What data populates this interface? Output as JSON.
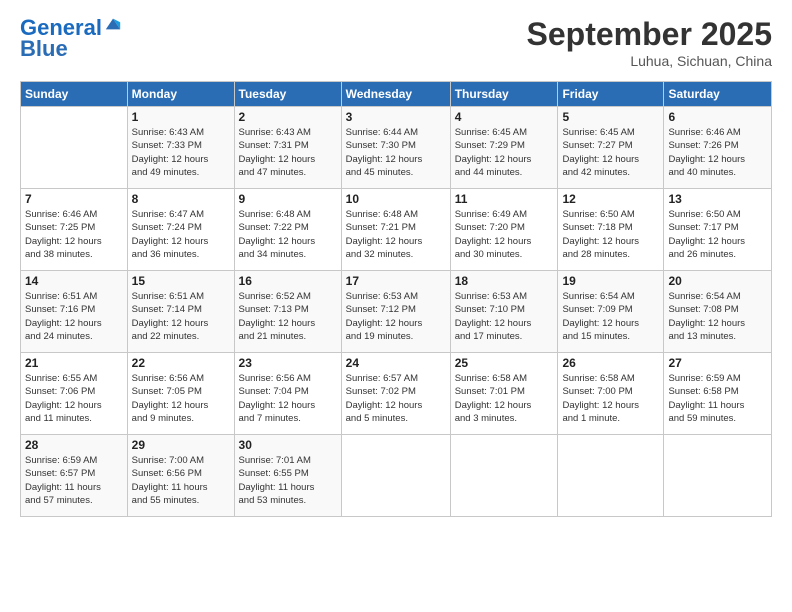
{
  "header": {
    "logo_line1": "General",
    "logo_line2": "Blue",
    "month_title": "September 2025",
    "location": "Luhua, Sichuan, China"
  },
  "weekdays": [
    "Sunday",
    "Monday",
    "Tuesday",
    "Wednesday",
    "Thursday",
    "Friday",
    "Saturday"
  ],
  "weeks": [
    [
      {
        "day": "",
        "info": ""
      },
      {
        "day": "1",
        "info": "Sunrise: 6:43 AM\nSunset: 7:33 PM\nDaylight: 12 hours\nand 49 minutes."
      },
      {
        "day": "2",
        "info": "Sunrise: 6:43 AM\nSunset: 7:31 PM\nDaylight: 12 hours\nand 47 minutes."
      },
      {
        "day": "3",
        "info": "Sunrise: 6:44 AM\nSunset: 7:30 PM\nDaylight: 12 hours\nand 45 minutes."
      },
      {
        "day": "4",
        "info": "Sunrise: 6:45 AM\nSunset: 7:29 PM\nDaylight: 12 hours\nand 44 minutes."
      },
      {
        "day": "5",
        "info": "Sunrise: 6:45 AM\nSunset: 7:27 PM\nDaylight: 12 hours\nand 42 minutes."
      },
      {
        "day": "6",
        "info": "Sunrise: 6:46 AM\nSunset: 7:26 PM\nDaylight: 12 hours\nand 40 minutes."
      }
    ],
    [
      {
        "day": "7",
        "info": "Sunrise: 6:46 AM\nSunset: 7:25 PM\nDaylight: 12 hours\nand 38 minutes."
      },
      {
        "day": "8",
        "info": "Sunrise: 6:47 AM\nSunset: 7:24 PM\nDaylight: 12 hours\nand 36 minutes."
      },
      {
        "day": "9",
        "info": "Sunrise: 6:48 AM\nSunset: 7:22 PM\nDaylight: 12 hours\nand 34 minutes."
      },
      {
        "day": "10",
        "info": "Sunrise: 6:48 AM\nSunset: 7:21 PM\nDaylight: 12 hours\nand 32 minutes."
      },
      {
        "day": "11",
        "info": "Sunrise: 6:49 AM\nSunset: 7:20 PM\nDaylight: 12 hours\nand 30 minutes."
      },
      {
        "day": "12",
        "info": "Sunrise: 6:50 AM\nSunset: 7:18 PM\nDaylight: 12 hours\nand 28 minutes."
      },
      {
        "day": "13",
        "info": "Sunrise: 6:50 AM\nSunset: 7:17 PM\nDaylight: 12 hours\nand 26 minutes."
      }
    ],
    [
      {
        "day": "14",
        "info": "Sunrise: 6:51 AM\nSunset: 7:16 PM\nDaylight: 12 hours\nand 24 minutes."
      },
      {
        "day": "15",
        "info": "Sunrise: 6:51 AM\nSunset: 7:14 PM\nDaylight: 12 hours\nand 22 minutes."
      },
      {
        "day": "16",
        "info": "Sunrise: 6:52 AM\nSunset: 7:13 PM\nDaylight: 12 hours\nand 21 minutes."
      },
      {
        "day": "17",
        "info": "Sunrise: 6:53 AM\nSunset: 7:12 PM\nDaylight: 12 hours\nand 19 minutes."
      },
      {
        "day": "18",
        "info": "Sunrise: 6:53 AM\nSunset: 7:10 PM\nDaylight: 12 hours\nand 17 minutes."
      },
      {
        "day": "19",
        "info": "Sunrise: 6:54 AM\nSunset: 7:09 PM\nDaylight: 12 hours\nand 15 minutes."
      },
      {
        "day": "20",
        "info": "Sunrise: 6:54 AM\nSunset: 7:08 PM\nDaylight: 12 hours\nand 13 minutes."
      }
    ],
    [
      {
        "day": "21",
        "info": "Sunrise: 6:55 AM\nSunset: 7:06 PM\nDaylight: 12 hours\nand 11 minutes."
      },
      {
        "day": "22",
        "info": "Sunrise: 6:56 AM\nSunset: 7:05 PM\nDaylight: 12 hours\nand 9 minutes."
      },
      {
        "day": "23",
        "info": "Sunrise: 6:56 AM\nSunset: 7:04 PM\nDaylight: 12 hours\nand 7 minutes."
      },
      {
        "day": "24",
        "info": "Sunrise: 6:57 AM\nSunset: 7:02 PM\nDaylight: 12 hours\nand 5 minutes."
      },
      {
        "day": "25",
        "info": "Sunrise: 6:58 AM\nSunset: 7:01 PM\nDaylight: 12 hours\nand 3 minutes."
      },
      {
        "day": "26",
        "info": "Sunrise: 6:58 AM\nSunset: 7:00 PM\nDaylight: 12 hours\nand 1 minute."
      },
      {
        "day": "27",
        "info": "Sunrise: 6:59 AM\nSunset: 6:58 PM\nDaylight: 11 hours\nand 59 minutes."
      }
    ],
    [
      {
        "day": "28",
        "info": "Sunrise: 6:59 AM\nSunset: 6:57 PM\nDaylight: 11 hours\nand 57 minutes."
      },
      {
        "day": "29",
        "info": "Sunrise: 7:00 AM\nSunset: 6:56 PM\nDaylight: 11 hours\nand 55 minutes."
      },
      {
        "day": "30",
        "info": "Sunrise: 7:01 AM\nSunset: 6:55 PM\nDaylight: 11 hours\nand 53 minutes."
      },
      {
        "day": "",
        "info": ""
      },
      {
        "day": "",
        "info": ""
      },
      {
        "day": "",
        "info": ""
      },
      {
        "day": "",
        "info": ""
      }
    ]
  ]
}
